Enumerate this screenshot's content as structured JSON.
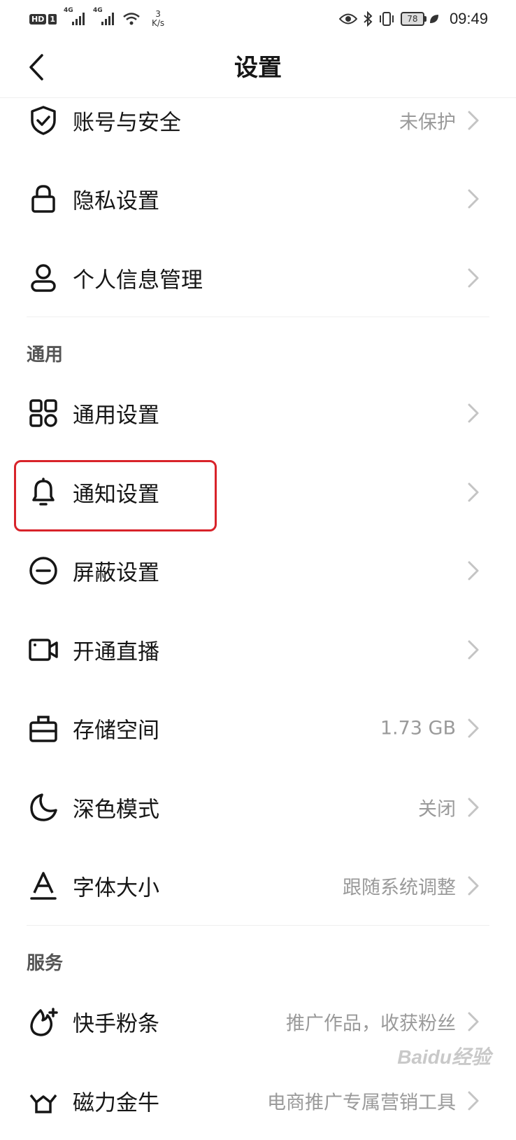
{
  "status_bar": {
    "hd": "HD",
    "sim": "1",
    "net1": "4G",
    "net2": "4G",
    "speed_value": "3",
    "speed_unit": "K/s",
    "battery": "78",
    "time": "09:49"
  },
  "header": {
    "title": "设置"
  },
  "sections": {
    "general": "通用",
    "services": "服务"
  },
  "items": [
    {
      "label": "账号与安全",
      "value": "未保护",
      "icon": "shield-check-icon"
    },
    {
      "label": "隐私设置",
      "value": "",
      "icon": "lock-icon"
    },
    {
      "label": "个人信息管理",
      "value": "",
      "icon": "person-icon"
    },
    {
      "label": "通用设置",
      "value": "",
      "icon": "grid-icon"
    },
    {
      "label": "通知设置",
      "value": "",
      "icon": "bell-icon"
    },
    {
      "label": "屏蔽设置",
      "value": "",
      "icon": "block-icon"
    },
    {
      "label": "开通直播",
      "value": "",
      "icon": "video-camera-icon"
    },
    {
      "label": "存储空间",
      "value": "1.73 GB",
      "icon": "storage-icon"
    },
    {
      "label": "深色模式",
      "value": "关闭",
      "icon": "moon-icon"
    },
    {
      "label": "字体大小",
      "value": "跟随系统调整",
      "icon": "font-icon"
    },
    {
      "label": "快手粉条",
      "value": "推广作品，收获粉丝",
      "icon": "flame-plus-icon"
    },
    {
      "label": "磁力金牛",
      "value": "电商推广专属营销工具",
      "icon": "bull-icon"
    }
  ],
  "watermark": "Baidu经验",
  "colors": {
    "highlight": "#d8232a",
    "value_text": "#9a9a9a"
  }
}
